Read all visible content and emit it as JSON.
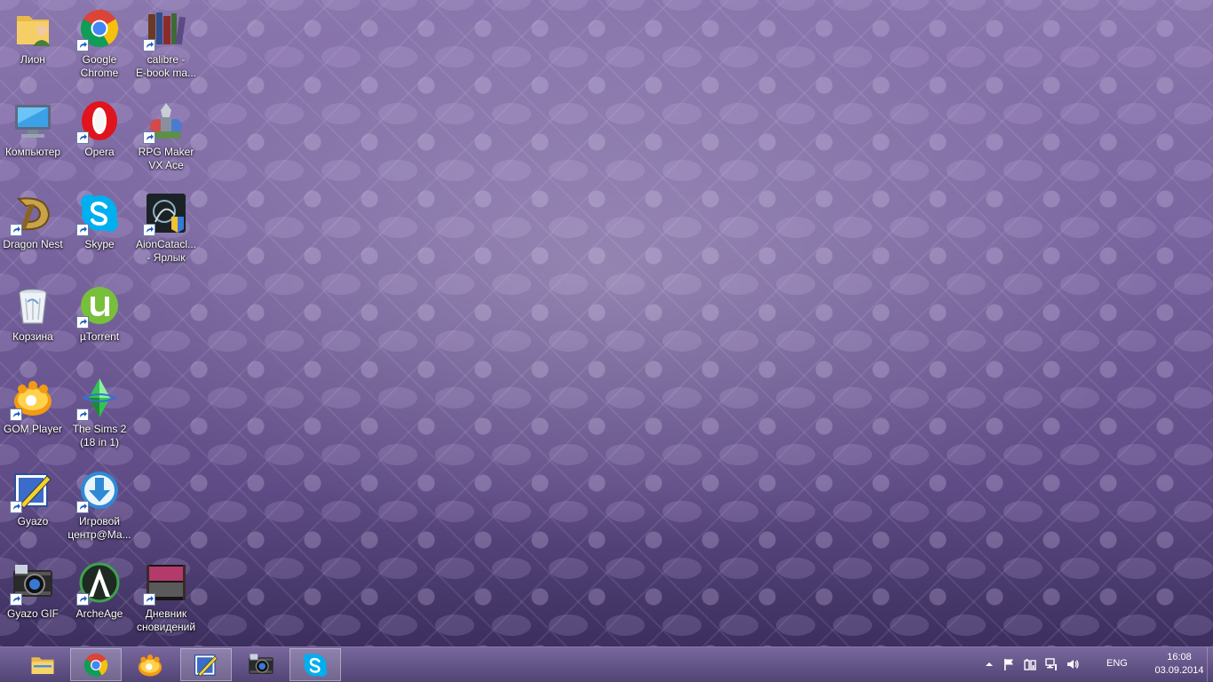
{
  "desktop": {
    "icons": [
      {
        "label": "Лион",
        "icon": "user-folder-icon",
        "shortcut": false
      },
      {
        "label": "Google\nChrome",
        "icon": "chrome-icon",
        "shortcut": true
      },
      {
        "label": "calibre -\nE-book ma...",
        "icon": "calibre-books-icon",
        "shortcut": true
      },
      {
        "label": "Компьютер",
        "icon": "computer-icon",
        "shortcut": false
      },
      {
        "label": "Opera",
        "icon": "opera-icon",
        "shortcut": true
      },
      {
        "label": "RPG Maker\nVX Ace",
        "icon": "rpg-maker-icon",
        "shortcut": true
      },
      {
        "label": "Dragon Nest",
        "icon": "dragon-nest-icon",
        "shortcut": true
      },
      {
        "label": "Skype",
        "icon": "skype-icon",
        "shortcut": true
      },
      {
        "label": "AionCatacl...\n- Ярлык",
        "icon": "aion-icon",
        "shortcut": true
      },
      {
        "label": "Корзина",
        "icon": "recycle-bin-icon",
        "shortcut": false
      },
      {
        "label": "µTorrent",
        "icon": "utorrent-icon",
        "shortcut": true
      },
      {
        "label": "GOM Player",
        "icon": "gom-player-icon",
        "shortcut": true
      },
      {
        "label": "The Sims 2\n(18 in 1)",
        "icon": "sims-icon",
        "shortcut": true
      },
      {
        "label": "Gyazo",
        "icon": "gyazo-icon",
        "shortcut": true
      },
      {
        "label": "Игровой\nцентр@Ма...",
        "icon": "game-center-icon",
        "shortcut": true
      },
      {
        "label": "Gyazo GIF",
        "icon": "gyazo-gif-icon",
        "shortcut": true
      },
      {
        "label": "ArcheAge",
        "icon": "archeage-icon",
        "shortcut": true
      },
      {
        "label": "Дневник\nсновидений",
        "icon": "yume-nikki-icon",
        "shortcut": true
      }
    ]
  },
  "taskbar": {
    "buttons": [
      {
        "icon": "file-explorer-icon",
        "active": false
      },
      {
        "icon": "chrome-icon",
        "active": true
      },
      {
        "icon": "gom-player-icon",
        "active": false
      },
      {
        "icon": "gyazo-icon",
        "active": true
      },
      {
        "icon": "gyazo-gif-icon",
        "active": false
      },
      {
        "icon": "skype-icon",
        "active": true
      }
    ],
    "tray": {
      "icons": [
        "show-hidden-icons-chevron",
        "action-center-flag-icon",
        "power-icon",
        "network-icon",
        "volume-icon"
      ],
      "language": "ENG",
      "time": "16:08",
      "date": "03.09.2014"
    }
  },
  "colors": {
    "wallpaper": "#7a66a0",
    "taskbar": "#5a4888"
  }
}
